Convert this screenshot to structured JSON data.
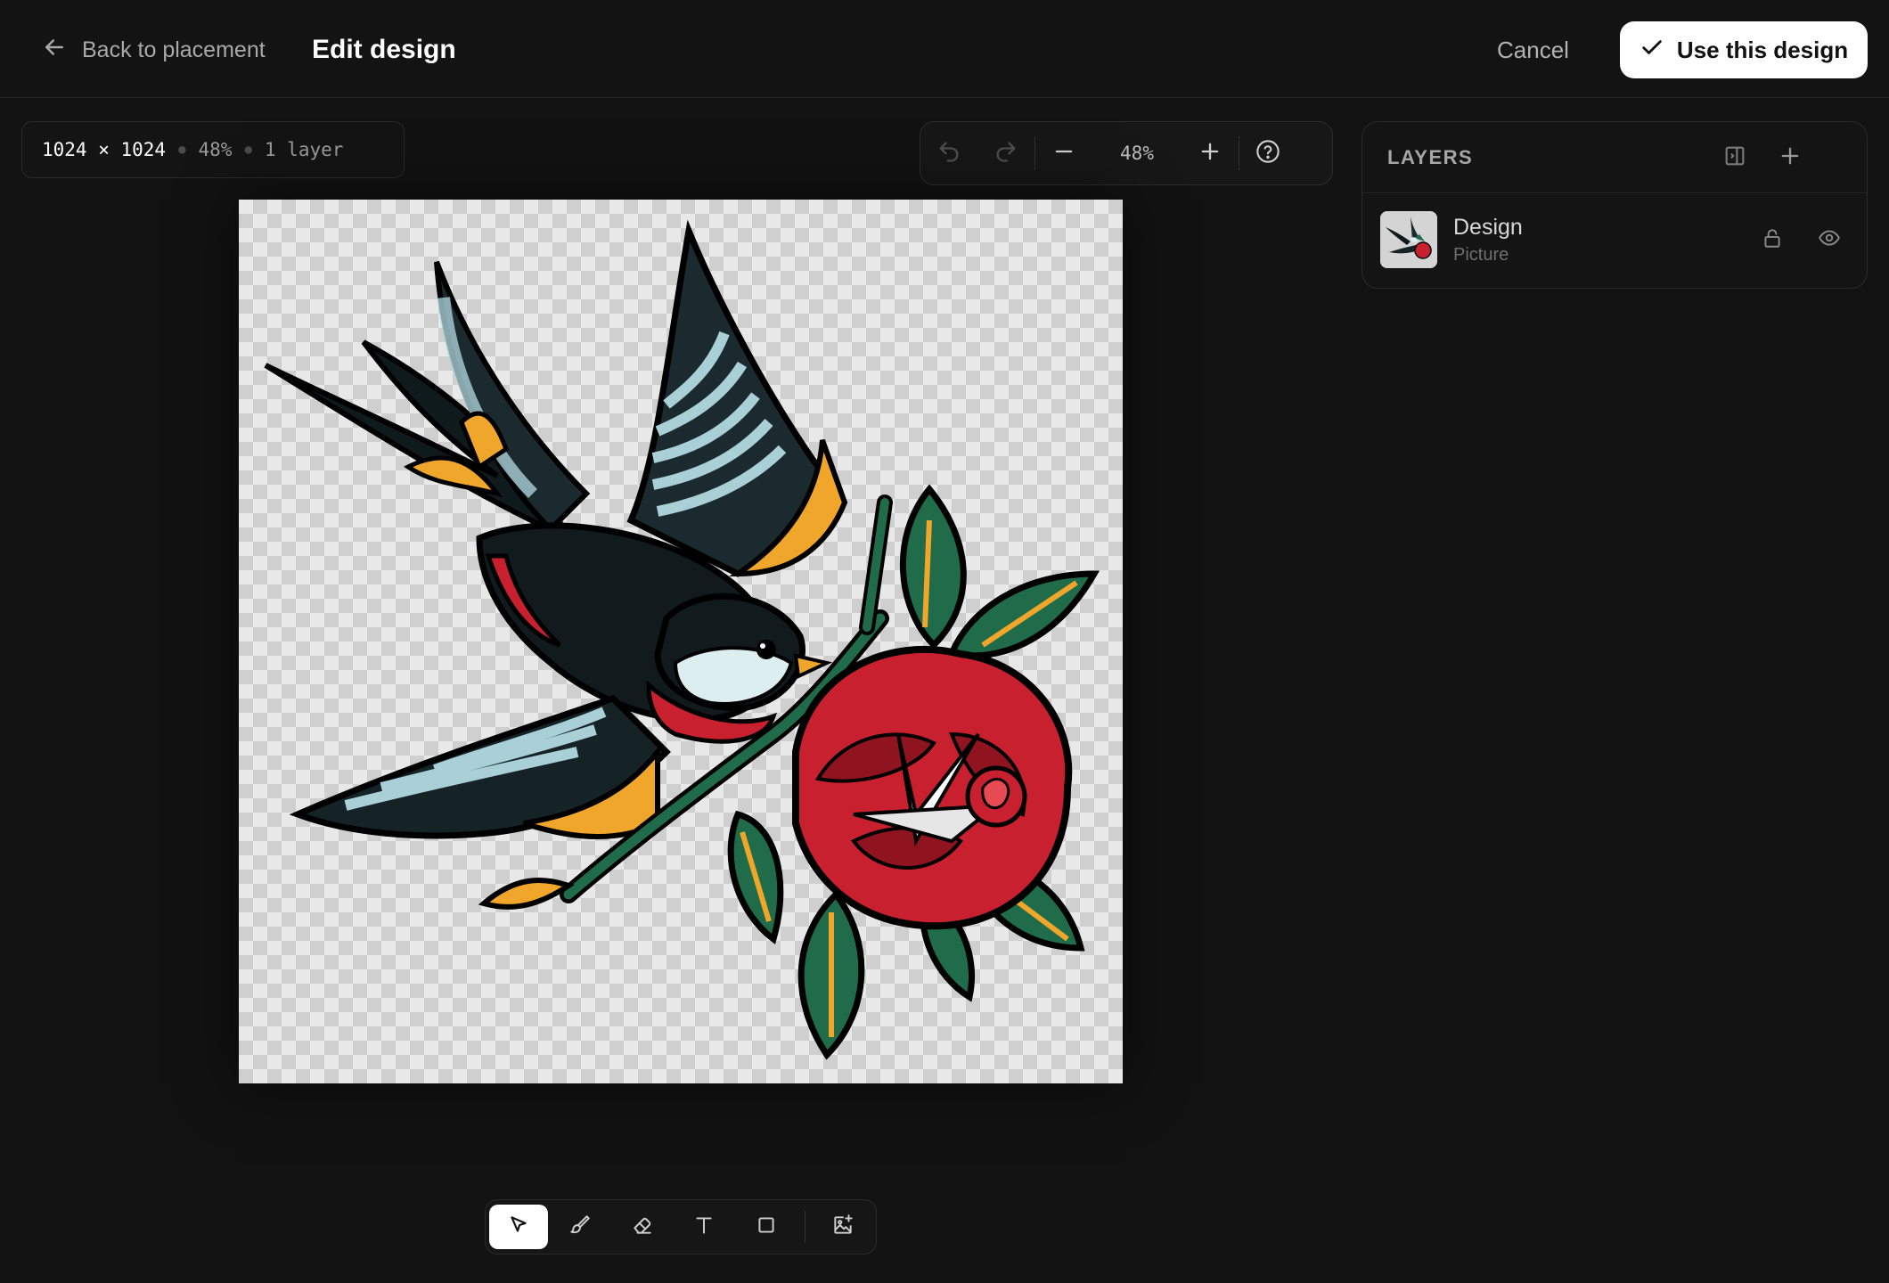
{
  "header": {
    "back_label": "Back to placement",
    "title": "Edit design",
    "cancel_label": "Cancel",
    "confirm_label": "Use this design"
  },
  "canvas_info": {
    "dimensions": "1024 × 1024",
    "zoom": "48%",
    "layers": "1 layer"
  },
  "zoom_toolbar": {
    "zoom_value": "48%",
    "icons": [
      "undo-icon",
      "redo-icon",
      "minus-icon",
      "plus-icon",
      "help-icon"
    ]
  },
  "layers_panel": {
    "title": "LAYERS",
    "items": [
      {
        "name": "Design",
        "type": "Picture",
        "icons": [
          "lock-icon",
          "eye-icon"
        ]
      }
    ]
  },
  "tools": {
    "items": [
      "select-tool",
      "brush-tool",
      "eraser-tool",
      "text-tool",
      "rectangle-tool",
      "image-add-tool"
    ],
    "active": "select-tool"
  },
  "colors": {
    "background": "#121212",
    "accent_button": "#ffffff",
    "rose_red": "#c8202e",
    "leaf_green": "#1f6b4a",
    "wing_blue": "#a9d0d6",
    "wing_orange": "#f0a62a"
  }
}
